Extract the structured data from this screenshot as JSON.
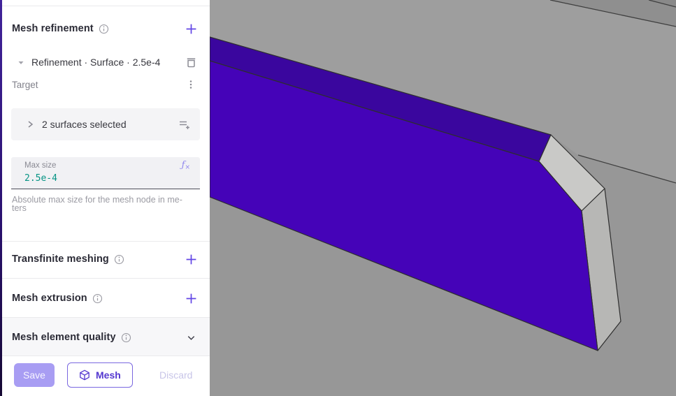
{
  "panel": {
    "mesh_refinement": {
      "title": "Mesh refinement"
    },
    "refinement_item": {
      "text": "Refinement · Surface · 2.5e-4"
    },
    "target": {
      "label": "Target"
    },
    "selection": {
      "text": "2 surfaces selected"
    },
    "max_size": {
      "label": "Max size",
      "value": "2.5e-4"
    },
    "help": {
      "line1": "Absolute max size for the mesh node in me-",
      "line2": "ters"
    },
    "sections": [
      {
        "title": "Transfinite meshing",
        "action": "add"
      },
      {
        "title": "Mesh extrusion",
        "action": "add"
      },
      {
        "title": "Mesh element quality",
        "action": "collapse"
      }
    ],
    "footer": {
      "save": "Save",
      "mesh": "Mesh",
      "discard": "Discard"
    }
  },
  "colors": {
    "accent": "#6246e5",
    "value_teal": "#069484",
    "save_bg": "#a89df3",
    "mesh_border": "#7a68e0",
    "mesh_text": "#5438d0",
    "discard_text": "#c8c5e8"
  },
  "viewport": {
    "colors": {
      "bg": "#979797",
      "plate_top": "#9e9e9e",
      "band": "#8f8f8f",
      "band_corner": "#898989",
      "slab_front": "#4503b8",
      "slab_top": "#3a069e",
      "chamfer": "#c9c9c7",
      "slab_side": "#b7b7b5",
      "edge": "#2e2e2e"
    }
  }
}
